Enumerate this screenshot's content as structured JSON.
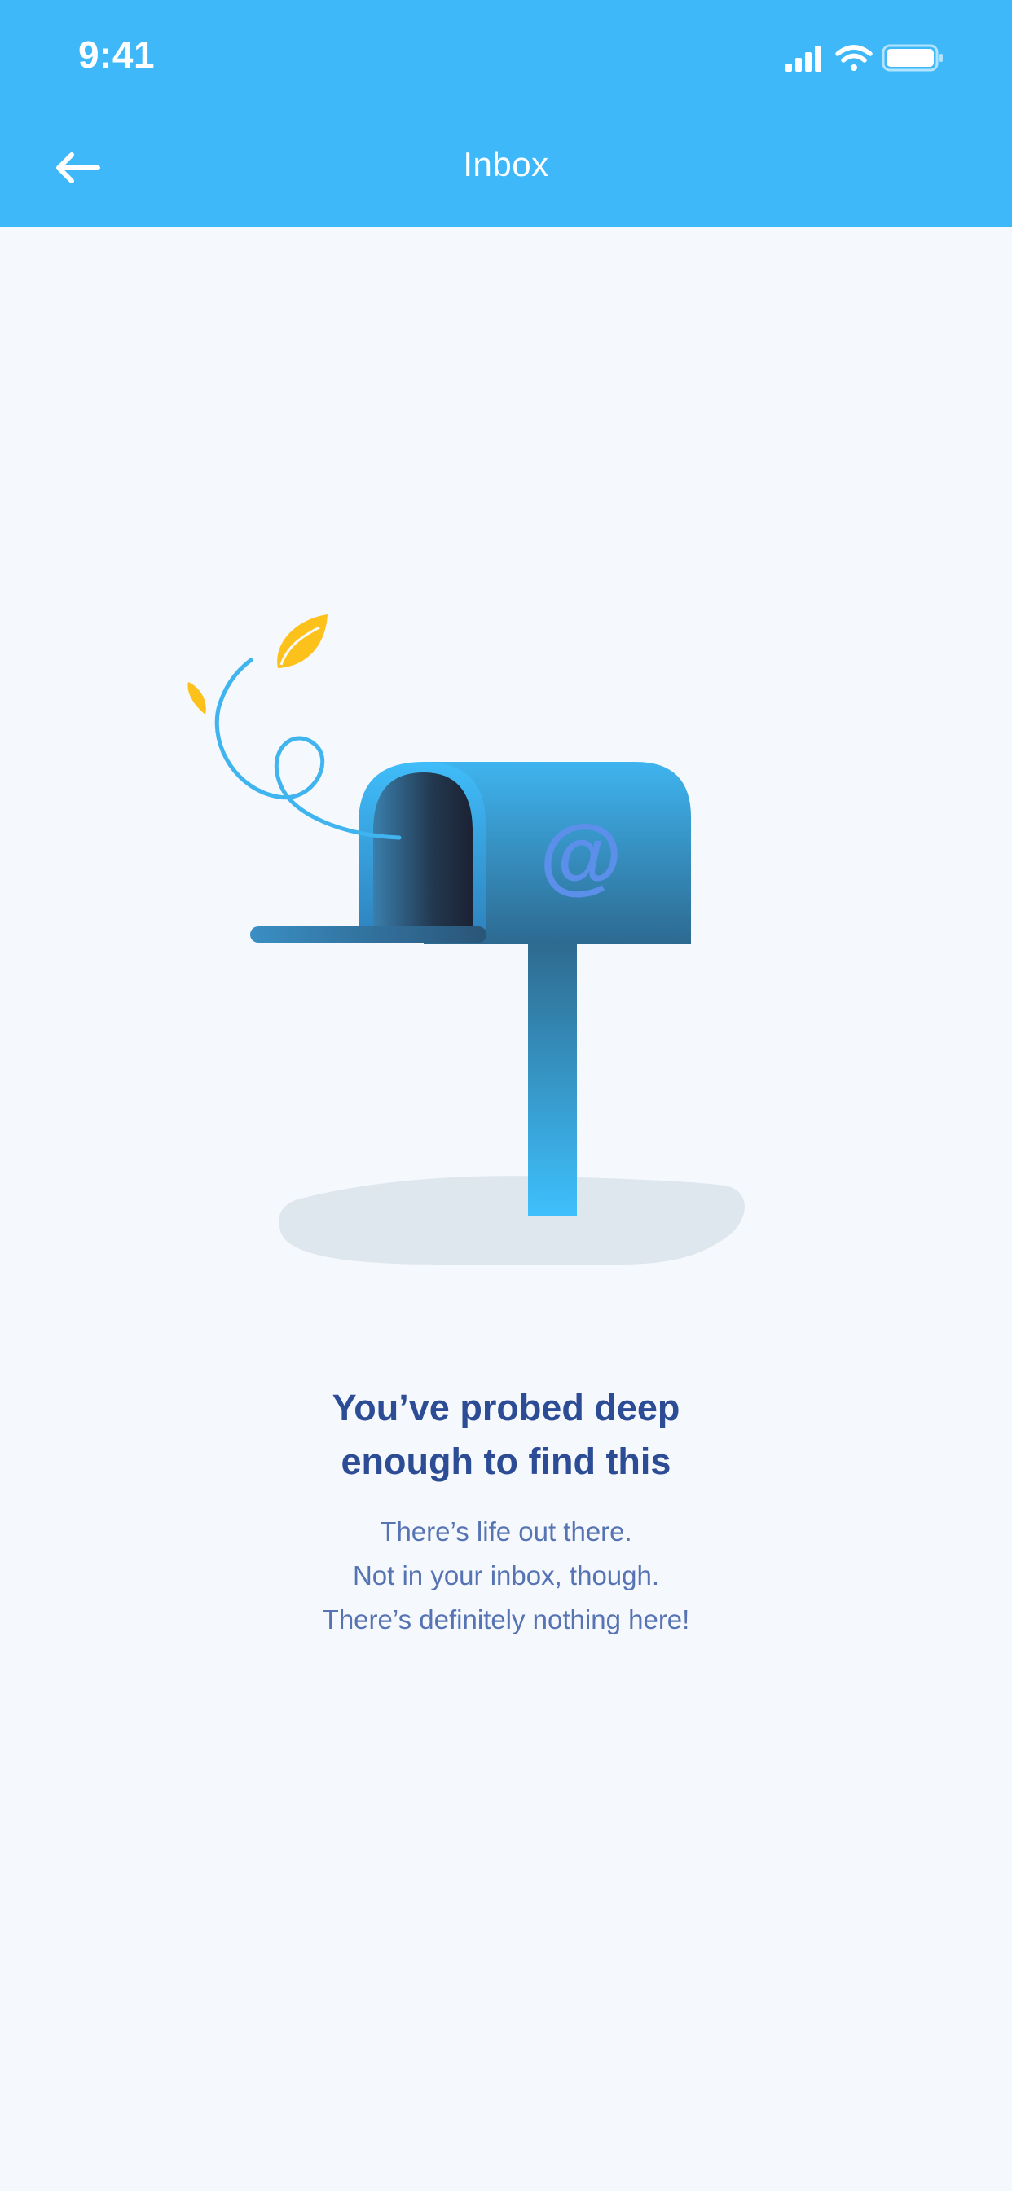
{
  "status_bar": {
    "time": "9:41",
    "icons": [
      "cellular-signal-icon",
      "wifi-icon",
      "battery-icon"
    ]
  },
  "nav": {
    "title": "Inbox",
    "back_icon": "back-arrow-icon"
  },
  "empty_state": {
    "illustration": "mailbox-illustration",
    "mailbox_symbol": "@",
    "headline_line1": "You’ve probed deep",
    "headline_line2": "enough to find this",
    "message_line1": "There’s life out there.",
    "message_line2": "Not in your inbox, though.",
    "message_line3": "There’s definitely nothing here!"
  },
  "colors": {
    "header": "#3eb8f9",
    "background": "#f5f8fc",
    "headline": "#2c4c95",
    "body_text": "#5673b3",
    "leaf": "#fcc21b"
  }
}
